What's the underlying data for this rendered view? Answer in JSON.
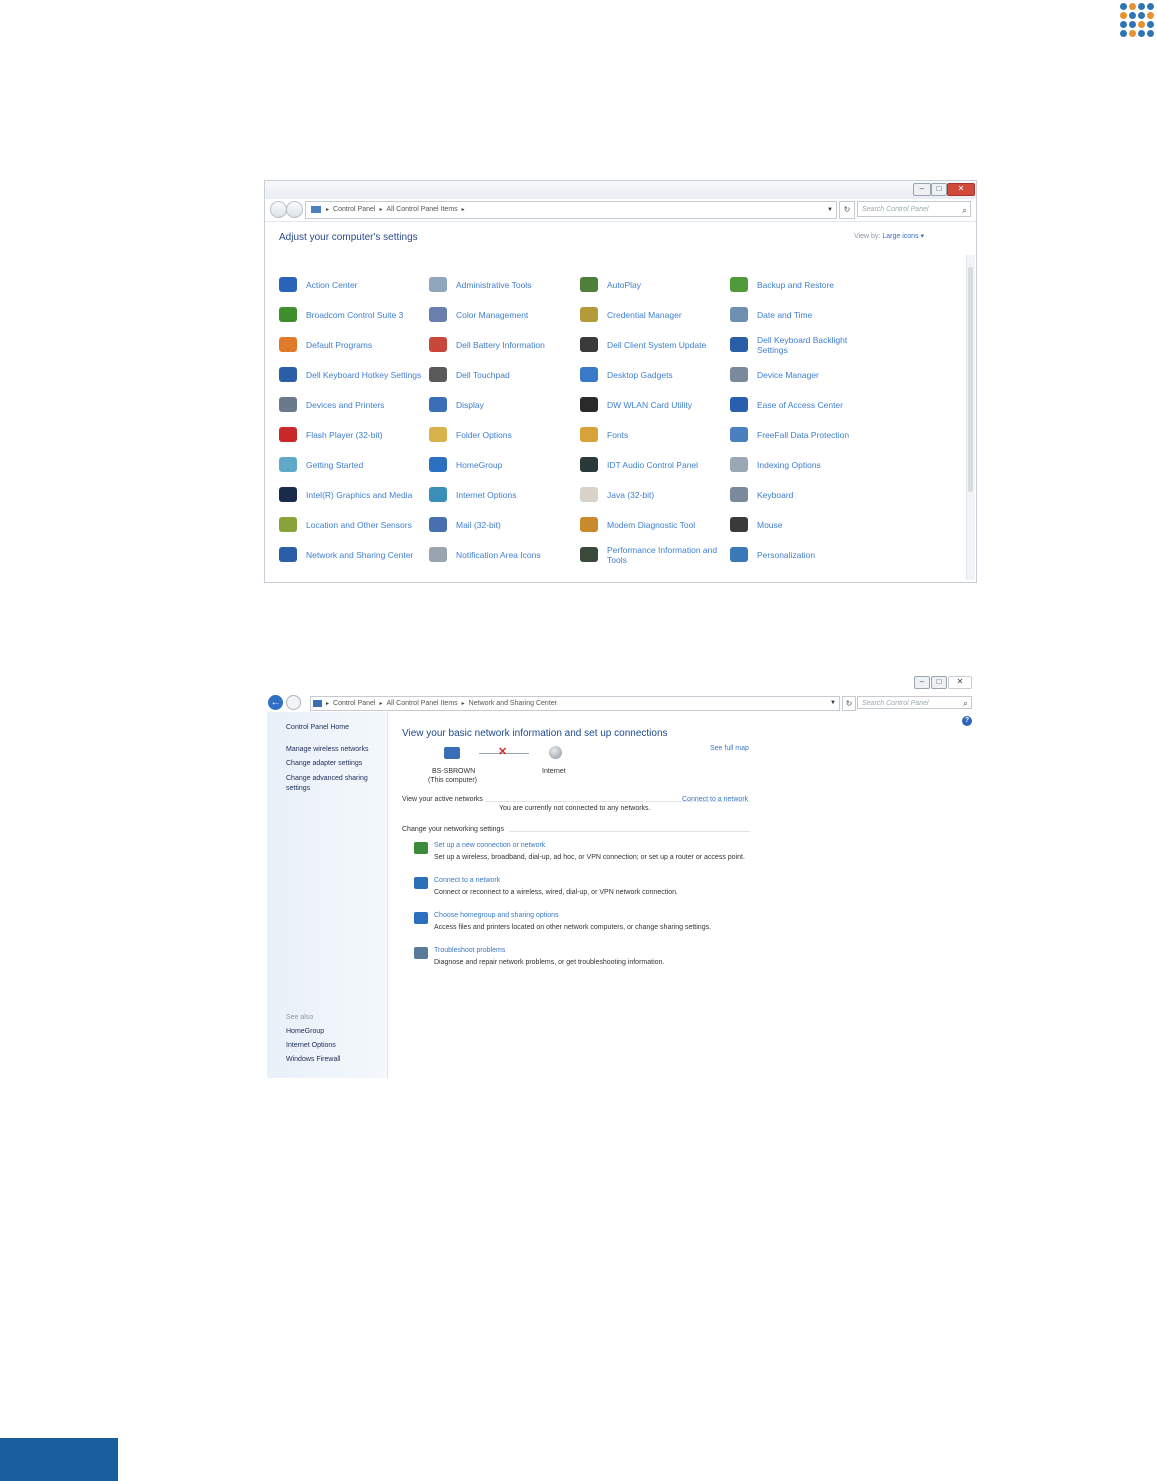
{
  "colors": {
    "accent_blue": "#1b5e9e",
    "link_blue": "#3a78c8",
    "logo_blue": "#2f74b5",
    "logo_orange": "#e8912f"
  },
  "window1": {
    "breadcrumb": [
      "Control Panel",
      "All Control Panel Items"
    ],
    "search_placeholder": "Search Control Panel",
    "heading": "Adjust your computer's settings",
    "view_by_label": "View by:",
    "view_by_value": "Large icons ▾",
    "items": [
      {
        "label": "Action Center",
        "icon": "flag-icon",
        "color": "#2a63b8"
      },
      {
        "label": "Administrative Tools",
        "icon": "tools-icon",
        "color": "#8fa6bd"
      },
      {
        "label": "AutoPlay",
        "icon": "autoplay-icon",
        "color": "#4f7f3a"
      },
      {
        "label": "Backup and Restore",
        "icon": "backup-icon",
        "color": "#4f9a3a"
      },
      {
        "label": "Broadcom Control Suite 3",
        "icon": "network-card-icon",
        "color": "#3f8f2f"
      },
      {
        "label": "Color Management",
        "icon": "color-icon",
        "color": "#6a7fae"
      },
      {
        "label": "Credential Manager",
        "icon": "vault-icon",
        "color": "#b59a3a"
      },
      {
        "label": "Date and Time",
        "icon": "clock-icon",
        "color": "#6f8fb0"
      },
      {
        "label": "Default Programs",
        "icon": "default-programs-icon",
        "color": "#e07a2a"
      },
      {
        "label": "Dell Battery Information",
        "icon": "battery-icon",
        "color": "#c8463a"
      },
      {
        "label": "Dell Client System Update",
        "icon": "update-icon",
        "color": "#3a3a3a"
      },
      {
        "label": "Dell Keyboard Backlight Settings",
        "icon": "dell-logo-icon",
        "color": "#2a5fa8"
      },
      {
        "label": "Dell Keyboard Hotkey Settings",
        "icon": "dell-logo-icon",
        "color": "#2a5fa8"
      },
      {
        "label": "Dell Touchpad",
        "icon": "touchpad-icon",
        "color": "#5a5a5a"
      },
      {
        "label": "Desktop Gadgets",
        "icon": "gadgets-icon",
        "color": "#3a78c8"
      },
      {
        "label": "Device Manager",
        "icon": "device-manager-icon",
        "color": "#7a8a9a"
      },
      {
        "label": "Devices and Printers",
        "icon": "printer-icon",
        "color": "#6a7a8a"
      },
      {
        "label": "Display",
        "icon": "display-icon",
        "color": "#3a6fb8"
      },
      {
        "label": "DW WLAN Card Utility",
        "icon": "wlan-icon",
        "color": "#2a2a2a"
      },
      {
        "label": "Ease of Access Center",
        "icon": "ease-of-access-icon",
        "color": "#2a5fb0"
      },
      {
        "label": "Flash Player (32-bit)",
        "icon": "flash-icon",
        "color": "#c8282a"
      },
      {
        "label": "Folder Options",
        "icon": "folder-icon",
        "color": "#d8b24a"
      },
      {
        "label": "Fonts",
        "icon": "fonts-icon",
        "color": "#d8a23a"
      },
      {
        "label": "FreeFall Data Protection",
        "icon": "freefall-icon",
        "color": "#4a7fc0"
      },
      {
        "label": "Getting Started",
        "icon": "getting-started-icon",
        "color": "#5fa8c8"
      },
      {
        "label": "HomeGroup",
        "icon": "homegroup-icon",
        "color": "#2a6fc0"
      },
      {
        "label": "IDT Audio Control Panel",
        "icon": "audio-icon",
        "color": "#2a3a3a"
      },
      {
        "label": "Indexing Options",
        "icon": "indexing-icon",
        "color": "#9aa8b6"
      },
      {
        "label": "Intel(R) Graphics and Media",
        "icon": "graphics-icon",
        "color": "#1a2a4a"
      },
      {
        "label": "Internet Options",
        "icon": "internet-icon",
        "color": "#3a8fb8"
      },
      {
        "label": "Java (32-bit)",
        "icon": "java-icon",
        "color": "#d8d2c8"
      },
      {
        "label": "Keyboard",
        "icon": "keyboard-icon",
        "color": "#7a8a9a"
      },
      {
        "label": "Location and Other Sensors",
        "icon": "sensors-icon",
        "color": "#8aa23a"
      },
      {
        "label": "Mail (32-bit)",
        "icon": "mail-icon",
        "color": "#4a6fb0"
      },
      {
        "label": "Modem Diagnostic Tool",
        "icon": "modem-icon",
        "color": "#c88a2a"
      },
      {
        "label": "Mouse",
        "icon": "mouse-icon",
        "color": "#3a3a3a"
      },
      {
        "label": "Network and Sharing Center",
        "icon": "network-icon",
        "color": "#2a5fa8"
      },
      {
        "label": "Notification Area Icons",
        "icon": "notification-icon",
        "color": "#9aa4ae"
      },
      {
        "label": "Performance Information and Tools",
        "icon": "performance-icon",
        "color": "#3a4a3a"
      },
      {
        "label": "Personalization",
        "icon": "personalization-icon",
        "color": "#3a78b8"
      }
    ]
  },
  "window2": {
    "breadcrumb": [
      "Control Panel",
      "All Control Panel Items",
      "Network and Sharing Center"
    ],
    "search_placeholder": "Search Control Panel",
    "sidebar": {
      "home": "Control Panel Home",
      "links": [
        "Manage wireless networks",
        "Change adapter settings",
        "Change advanced sharing settings"
      ],
      "see_also_label": "See also",
      "see_also": [
        "HomeGroup",
        "Internet Options",
        "Windows Firewall"
      ]
    },
    "title": "View your basic network information and set up connections",
    "computer_name": "BS-SBROWN",
    "computer_sub": "(This computer)",
    "internet_label": "Internet",
    "see_full_map": "See full map",
    "active_networks_label": "View your active networks",
    "connect_to_network": "Connect to a network",
    "not_connected": "You are currently not connected to any networks.",
    "change_settings_label": "Change your networking settings",
    "tasks": [
      {
        "title": "Set up a new connection or network",
        "desc": "Set up a wireless, broadband, dial-up, ad hoc, or VPN connection; or set up a router or access point.",
        "icon": "new-connection-icon"
      },
      {
        "title": "Connect to a network",
        "desc": "Connect or reconnect to a wireless, wired, dial-up, or VPN network connection.",
        "icon": "connect-network-icon"
      },
      {
        "title": "Choose homegroup and sharing options",
        "desc": "Access files and printers located on other network computers, or change sharing settings.",
        "icon": "homegroup-icon"
      },
      {
        "title": "Troubleshoot problems",
        "desc": "Diagnose and repair network problems, or get troubleshooting information.",
        "icon": "troubleshoot-icon"
      }
    ]
  }
}
